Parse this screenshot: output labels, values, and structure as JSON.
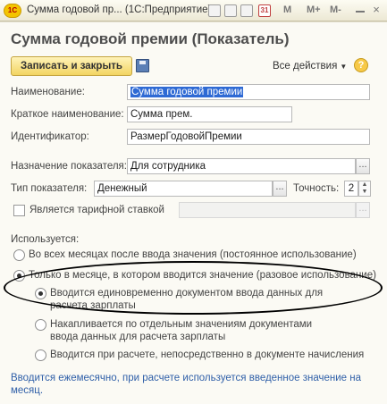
{
  "window": {
    "title": "Сумма годовой пр... (1С:Предприятие)",
    "calendar_day": "31",
    "toolbar_m": "M",
    "toolbar_m_plus": "M+",
    "toolbar_m_minus": "M-"
  },
  "form": {
    "heading": "Сумма годовой премии (Показатель)",
    "save_close_label": "Записать и закрыть",
    "all_actions_label": "Все действия",
    "help_label": "?",
    "name_label": "Наименование:",
    "name_value": "Сумма годовой премии",
    "short_name_label": "Краткое наименование:",
    "short_name_value": "Сумма прем.",
    "identifier_label": "Идентификатор:",
    "identifier_value": "РазмерГодовойПремии",
    "purpose_label": "Назначение показателя:",
    "purpose_value": "Для сотрудника",
    "type_label": "Тип показателя:",
    "type_value": "Денежный",
    "precision_label": "Точность:",
    "precision_value": "2",
    "tariff_label": "Является тарифной ставкой",
    "tariff_checked": false,
    "used_label": "Используется:",
    "choose_button": "...",
    "usage_options": [
      {
        "label": "Во всех месяцах после ввода значения (постоянное использование)",
        "selected": false
      },
      {
        "label": "Только в месяце, в котором вводится значение (разовое использование)",
        "selected": true
      }
    ],
    "sub_options": [
      {
        "label": "Вводится единовременно документом ввода данных для расчета зарплаты",
        "selected": true
      },
      {
        "label": "Накапливается по отдельным значениям документами ввода данных для расчета зарплаты",
        "selected": false
      },
      {
        "label": "Вводится при расчете, непосредственно в документе начисления",
        "selected": false
      }
    ],
    "note": "Вводится ежемесячно, при расчете используется введенное значение на месяц."
  }
}
